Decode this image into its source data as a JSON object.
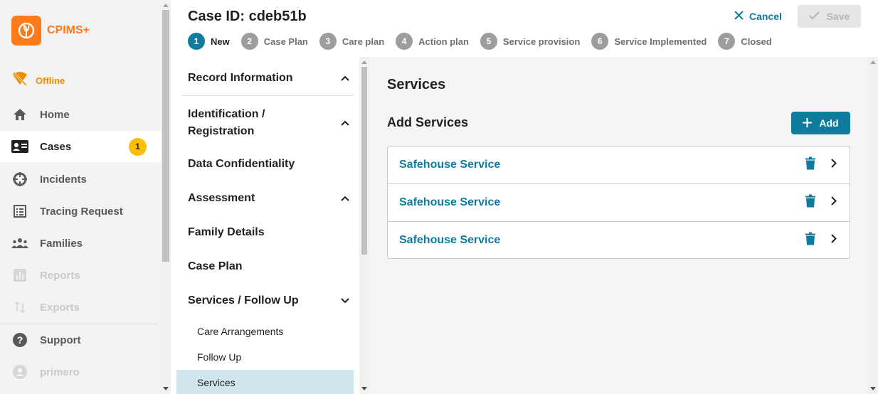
{
  "app": {
    "name": "CPIMS+"
  },
  "status": {
    "offline_label": "Offline"
  },
  "nav": {
    "items": [
      {
        "label": "Home",
        "icon": "home-icon",
        "state": "normal"
      },
      {
        "label": "Cases",
        "icon": "id-card-icon",
        "state": "active",
        "badge": "1"
      },
      {
        "label": "Incidents",
        "icon": "crosshair-icon",
        "state": "normal"
      },
      {
        "label": "Tracing Request",
        "icon": "list-icon",
        "state": "normal"
      },
      {
        "label": "Families",
        "icon": "people-icon",
        "state": "normal"
      },
      {
        "label": "Reports",
        "icon": "bar-chart-icon",
        "state": "disabled"
      },
      {
        "label": "Exports",
        "icon": "swap-vertical-icon",
        "state": "disabled"
      },
      {
        "label": "Support",
        "icon": "help-icon",
        "state": "normal"
      },
      {
        "label": "primero",
        "icon": "user-icon",
        "state": "disabled"
      }
    ]
  },
  "header": {
    "title": "Case ID: cdeb51b",
    "cancel_label": "Cancel",
    "save_label": "Save"
  },
  "workflow": {
    "steps": [
      {
        "number": "1",
        "label": "New",
        "current": true
      },
      {
        "number": "2",
        "label": "Case Plan"
      },
      {
        "number": "3",
        "label": "Care plan"
      },
      {
        "number": "4",
        "label": "Action plan"
      },
      {
        "number": "5",
        "label": "Service provision"
      },
      {
        "number": "6",
        "label": "Service Implemented"
      },
      {
        "number": "7",
        "label": "Closed"
      }
    ]
  },
  "form_nav": {
    "sections": [
      {
        "label": "Record Information",
        "chevron": "up"
      },
      {
        "label": "Identification / Registration",
        "chevron": "up"
      },
      {
        "label": "Data Confidentiality"
      },
      {
        "label": "Assessment",
        "chevron": "up"
      },
      {
        "label": "Family Details"
      },
      {
        "label": "Case Plan"
      },
      {
        "label": "Services / Follow Up",
        "chevron": "down"
      }
    ],
    "subsections": [
      {
        "label": "Care Arrangements"
      },
      {
        "label": "Follow Up"
      },
      {
        "label": "Services",
        "active": true
      }
    ]
  },
  "main": {
    "title": "Services",
    "add_section_title": "Add Services",
    "add_label": "Add",
    "services": [
      {
        "name": "Safehouse Service"
      },
      {
        "name": "Safehouse Service"
      },
      {
        "name": "Safehouse Service"
      }
    ]
  },
  "colors": {
    "brand_orange": "#ff7a1a",
    "primary_teal": "#0f7b9d",
    "badge_yellow": "#fbbf00",
    "active_sub_bg": "#cfe6ec"
  }
}
